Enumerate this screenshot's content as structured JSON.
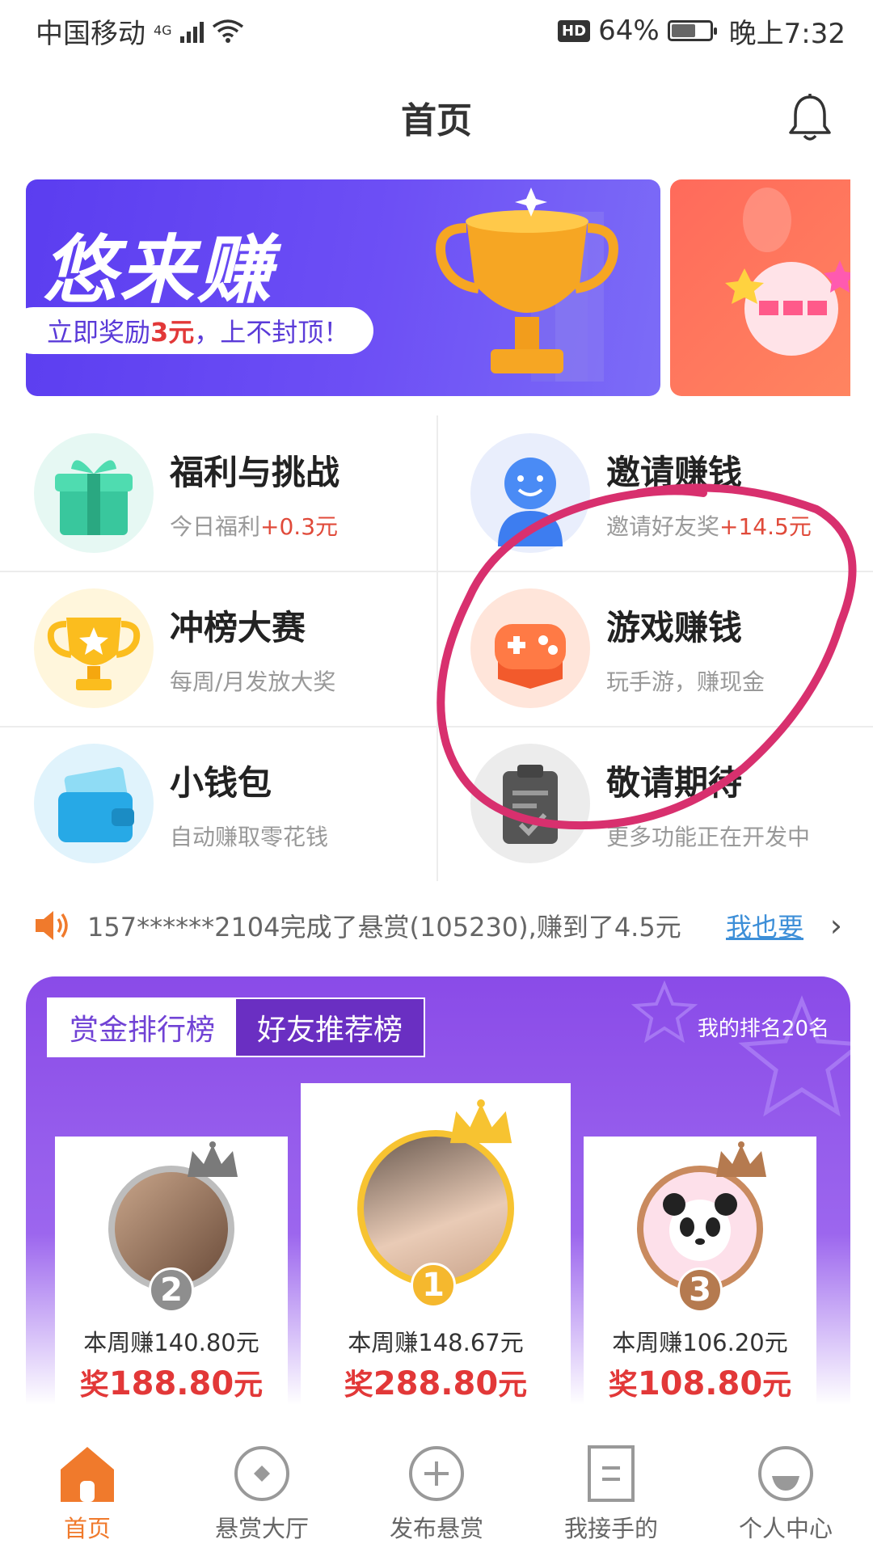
{
  "status_bar": {
    "carrier": "中国移动",
    "network": "4G",
    "hd": "HD",
    "battery": "64%",
    "battery_level": 0.64,
    "time": "晚上7:32"
  },
  "header": {
    "title": "首页"
  },
  "banner": {
    "headline": "悠来赚",
    "pill_prefix": "立即奖励",
    "pill_amount": "3元",
    "pill_suffix": "，上不封顶！"
  },
  "features": [
    {
      "title": "福利与挑战",
      "sub_prefix": "今日福利",
      "sub_highlight": "+0.3元"
    },
    {
      "title": "邀请赚钱",
      "sub_prefix": "邀请好友奖",
      "sub_highlight": "+14.5元"
    },
    {
      "title": "冲榜大赛",
      "sub_prefix": "每周/月发放大奖",
      "sub_highlight": ""
    },
    {
      "title": "游戏赚钱",
      "sub_prefix": "玩手游，赚现金",
      "sub_highlight": ""
    },
    {
      "title": "小钱包",
      "sub_prefix": "自动赚取零花钱",
      "sub_highlight": ""
    },
    {
      "title": "敬请期待",
      "sub_prefix": "更多功能正在开发中",
      "sub_highlight": ""
    }
  ],
  "ticker": {
    "text": "157******2104完成了悬赏(105230),赚到了4.5元",
    "link": "我也要"
  },
  "ranking": {
    "tabs": [
      "赏金排行榜",
      "好友推荐榜"
    ],
    "active_tab": "赏金排行榜",
    "my_rank": "我的排名20名",
    "cards": [
      {
        "rank": "2",
        "earned": "本周赚140.80元",
        "prize_prefix": "奖",
        "prize_amount": "188.80",
        "prize_unit": "元"
      },
      {
        "rank": "1",
        "earned": "本周赚148.67元",
        "prize_prefix": "奖",
        "prize_amount": "288.80",
        "prize_unit": "元"
      },
      {
        "rank": "3",
        "earned": "本周赚106.20元",
        "prize_prefix": "奖",
        "prize_amount": "108.80",
        "prize_unit": "元"
      }
    ]
  },
  "bottom_nav": [
    {
      "label": "首页",
      "icon": "home-icon",
      "active": true
    },
    {
      "label": "悬赏大厅",
      "icon": "bounty-hall-icon",
      "active": false
    },
    {
      "label": "发布悬赏",
      "icon": "plus-circle-icon",
      "active": false
    },
    {
      "label": "我接手的",
      "icon": "document-icon",
      "active": false
    },
    {
      "label": "个人中心",
      "icon": "profile-icon",
      "active": false
    }
  ],
  "colors": {
    "accent_orange": "#f07a2c",
    "banner_purple": "#5b3df0",
    "rank_purple": "#8a4be8",
    "prize_red": "#e23838",
    "link_blue": "#3d8fd8",
    "annotation_magenta": "#d8306e"
  }
}
